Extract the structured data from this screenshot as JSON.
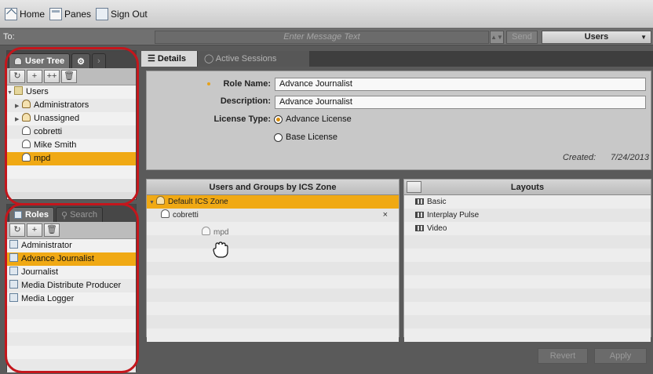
{
  "toolbar": {
    "home_label": "Home",
    "panes_label": "Panes",
    "signout_label": "Sign Out"
  },
  "message_bar": {
    "to_label": "To:",
    "placeholder": "Enter Message Text",
    "send_label": "Send",
    "recipient_select": "Users"
  },
  "user_tree": {
    "tab_label": "User Tree",
    "items": [
      {
        "label": "Users",
        "kind": "folder",
        "expanded": true
      },
      {
        "label": "Administrators",
        "kind": "group"
      },
      {
        "label": "Unassigned",
        "kind": "group"
      },
      {
        "label": "cobretti",
        "kind": "user"
      },
      {
        "label": "Mike Smith",
        "kind": "user"
      },
      {
        "label": "mpd",
        "kind": "user",
        "selected": true
      }
    ]
  },
  "roles": {
    "tab_label": "Roles",
    "search_tab_label": "Search",
    "items": [
      {
        "label": "Administrator"
      },
      {
        "label": "Advance Journalist",
        "selected": true
      },
      {
        "label": "Journalist"
      },
      {
        "label": "Media Distribute Producer"
      },
      {
        "label": "Media Logger"
      }
    ]
  },
  "content_tabs": {
    "details_label": "Details",
    "sessions_label": "Active Sessions"
  },
  "details": {
    "role_name_label": "Role Name:",
    "role_name_value": "Advance Journalist",
    "description_label": "Description:",
    "description_value": "Advance Journalist",
    "license_type_label": "License Type:",
    "license_advance_label": "Advance License",
    "license_base_label": "Base License",
    "created_label": "Created:",
    "created_value": "7/24/2013"
  },
  "zone_panel": {
    "title": "Users and Groups by ICS Zone",
    "zone_label": "Default ICS Zone",
    "member_label": "cobretti",
    "remove_glyph": "×",
    "drag_label": "mpd"
  },
  "layouts_panel": {
    "title": "Layouts",
    "items": [
      "Basic",
      "Interplay Pulse",
      "Video"
    ]
  },
  "actions": {
    "revert_label": "Revert",
    "apply_label": "Apply"
  },
  "colors": {
    "selection": "#f0a914",
    "annotation": "#c4161c"
  }
}
